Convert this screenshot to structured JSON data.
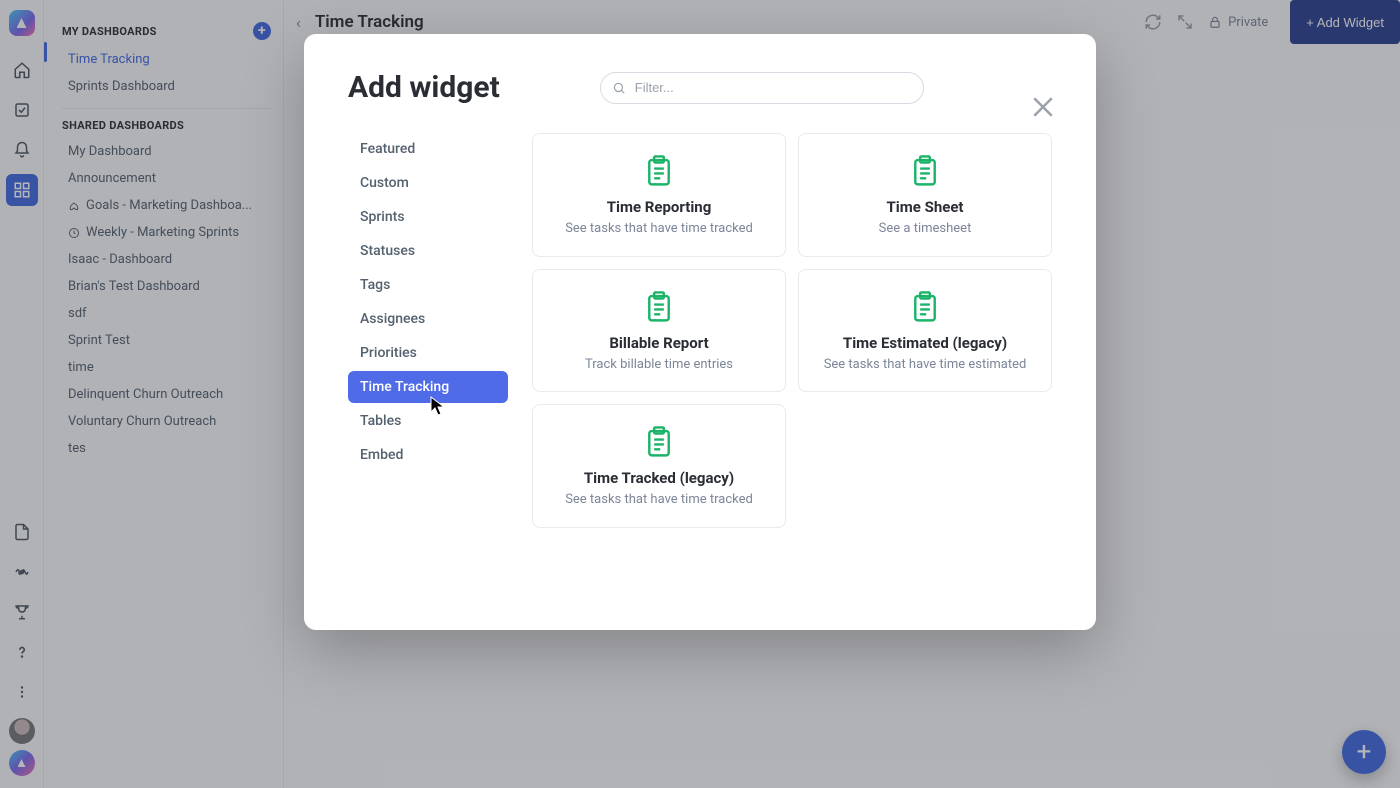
{
  "sidebar": {
    "section_my": "MY DASHBOARDS",
    "my_items": [
      {
        "label": "Time Tracking",
        "active": true
      },
      {
        "label": "Sprints Dashboard",
        "active": false
      }
    ],
    "section_shared": "SHARED DASHBOARDS",
    "shared_items": [
      {
        "label": "My Dashboard",
        "icon": ""
      },
      {
        "label": "Announcement",
        "icon": ""
      },
      {
        "label": "Goals - Marketing Dashboa...",
        "icon": "rocket"
      },
      {
        "label": "Weekly - Marketing Sprints",
        "icon": "clock"
      },
      {
        "label": "Isaac - Dashboard",
        "icon": ""
      },
      {
        "label": "Brian's Test Dashboard",
        "icon": ""
      },
      {
        "label": "sdf",
        "icon": ""
      },
      {
        "label": "Sprint Test",
        "icon": ""
      },
      {
        "label": "time",
        "icon": ""
      },
      {
        "label": "Delinquent Churn Outreach",
        "icon": ""
      },
      {
        "label": "Voluntary Churn Outreach",
        "icon": ""
      },
      {
        "label": "tes",
        "icon": ""
      }
    ]
  },
  "header": {
    "page_title": "Time Tracking",
    "privacy_label": "Private",
    "add_widget_label": "+ Add Widget"
  },
  "modal": {
    "title": "Add widget",
    "filter_placeholder": "Filter...",
    "categories": [
      "Featured",
      "Custom",
      "Sprints",
      "Statuses",
      "Tags",
      "Assignees",
      "Priorities",
      "Time Tracking",
      "Tables",
      "Embed"
    ],
    "selected_category": "Time Tracking",
    "widgets": [
      {
        "title": "Time Reporting",
        "desc": "See tasks that have time tracked"
      },
      {
        "title": "Time Sheet",
        "desc": "See a timesheet"
      },
      {
        "title": "Billable Report",
        "desc": "Track billable time entries"
      },
      {
        "title": "Time Estimated (legacy)",
        "desc": "See tasks that have time estimated"
      },
      {
        "title": "Time Tracked (legacy)",
        "desc": "See tasks that have time tracked"
      }
    ]
  },
  "colors": {
    "primary": "#4169e1",
    "accent_green": "#1bb469",
    "button_dark": "#2a3f8f"
  }
}
